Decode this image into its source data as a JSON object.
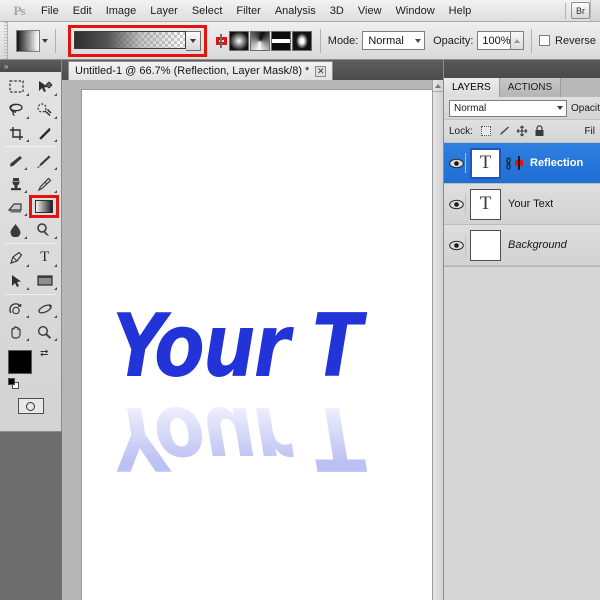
{
  "app": {
    "logo": "Ps"
  },
  "menubar": {
    "items": [
      {
        "label": "File"
      },
      {
        "label": "Edit"
      },
      {
        "label": "Image"
      },
      {
        "label": "Layer"
      },
      {
        "label": "Select"
      },
      {
        "label": "Filter"
      },
      {
        "label": "Analysis"
      },
      {
        "label": "3D"
      },
      {
        "label": "View"
      },
      {
        "label": "Window"
      },
      {
        "label": "Help"
      }
    ],
    "bridge_button": "Br"
  },
  "options_bar": {
    "tool_preset_name": "gradient-tool-preset",
    "gradient_swatch_name": "black-to-transparent",
    "gradient_types": [
      {
        "name": "linear-gradient",
        "selected": true
      },
      {
        "name": "radial-gradient",
        "selected": false
      },
      {
        "name": "angle-gradient",
        "selected": false
      },
      {
        "name": "reflected-gradient",
        "selected": false
      },
      {
        "name": "diamond-gradient",
        "selected": false
      }
    ],
    "mode_label": "Mode:",
    "mode_value": "Normal",
    "opacity_label": "Opacity:",
    "opacity_value": "100%",
    "reverse_label": "Reverse",
    "reverse_checked": false
  },
  "toolbar": {
    "tools": [
      {
        "name": "rectangular-marquee-tool"
      },
      {
        "name": "move-tool"
      },
      {
        "name": "lasso-tool"
      },
      {
        "name": "quick-selection-tool"
      },
      {
        "name": "crop-tool"
      },
      {
        "name": "eyedropper-tool"
      },
      {
        "name": "healing-brush-tool"
      },
      {
        "name": "brush-tool"
      },
      {
        "name": "clone-stamp-tool"
      },
      {
        "name": "history-brush-tool"
      },
      {
        "name": "eraser-tool"
      },
      {
        "name": "gradient-tool"
      },
      {
        "name": "blur-tool"
      },
      {
        "name": "dodge-tool"
      },
      {
        "name": "pen-tool"
      },
      {
        "name": "type-tool"
      },
      {
        "name": "path-selection-tool"
      },
      {
        "name": "rectangle-tool"
      },
      {
        "name": "rotate-view-tool"
      },
      {
        "name": "3d-orbit-tool"
      },
      {
        "name": "hand-tool"
      },
      {
        "name": "zoom-tool"
      }
    ],
    "type_tool_glyph": "T",
    "foreground_color": "#000000",
    "background_color": "#ffffff",
    "quick_mask_name": "quick-mask-mode"
  },
  "document": {
    "tab_title": "Untitled-1 @ 66.7% (Reflection, Layer Mask/8) *",
    "close_glyph": "✕",
    "zoom": "66.7%",
    "artwork_text": "Your T",
    "artwork_color": "#2233d8",
    "canvas_background": "#ffffff"
  },
  "layers_panel": {
    "tabs": [
      {
        "label": "LAYERS",
        "active": true
      },
      {
        "label": "ACTIONS",
        "active": false
      }
    ],
    "blend_mode": "Normal",
    "opacity_label": "Opacity",
    "lock_label": "Lock:",
    "fill_label": "Fil",
    "layers": [
      {
        "name": "Reflection",
        "thumb_glyph": "T",
        "selected": true,
        "has_mask": true,
        "mask_highlighted": true,
        "visible": true
      },
      {
        "name": "Your Text",
        "thumb_glyph": "T",
        "selected": false,
        "has_mask": false,
        "mask_highlighted": false,
        "visible": true
      },
      {
        "name": "Background",
        "thumb_glyph": "",
        "selected": false,
        "has_mask": false,
        "mask_highlighted": false,
        "visible": true
      }
    ]
  },
  "accent_colors": {
    "highlight_box": "#e2140f",
    "selection_blue": "#2f7fe0",
    "artwork_blue": "#2233d8"
  }
}
